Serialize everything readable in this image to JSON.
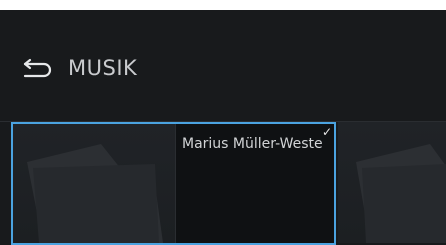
{
  "header": {
    "back_icon": "back-arrow-icon",
    "title": "MUSIK"
  },
  "tiles": [
    {
      "label": "Marius Müller-Weste",
      "art_icon": "folder-icon",
      "selected": true,
      "check_icon": "check-icon",
      "check_glyph": "✓"
    },
    {
      "label": "",
      "art_icon": "folder-icon",
      "selected": false
    }
  ],
  "colors": {
    "background": "#181a1c",
    "selection_border": "#4ba3e0",
    "text": "#c9cbce"
  }
}
